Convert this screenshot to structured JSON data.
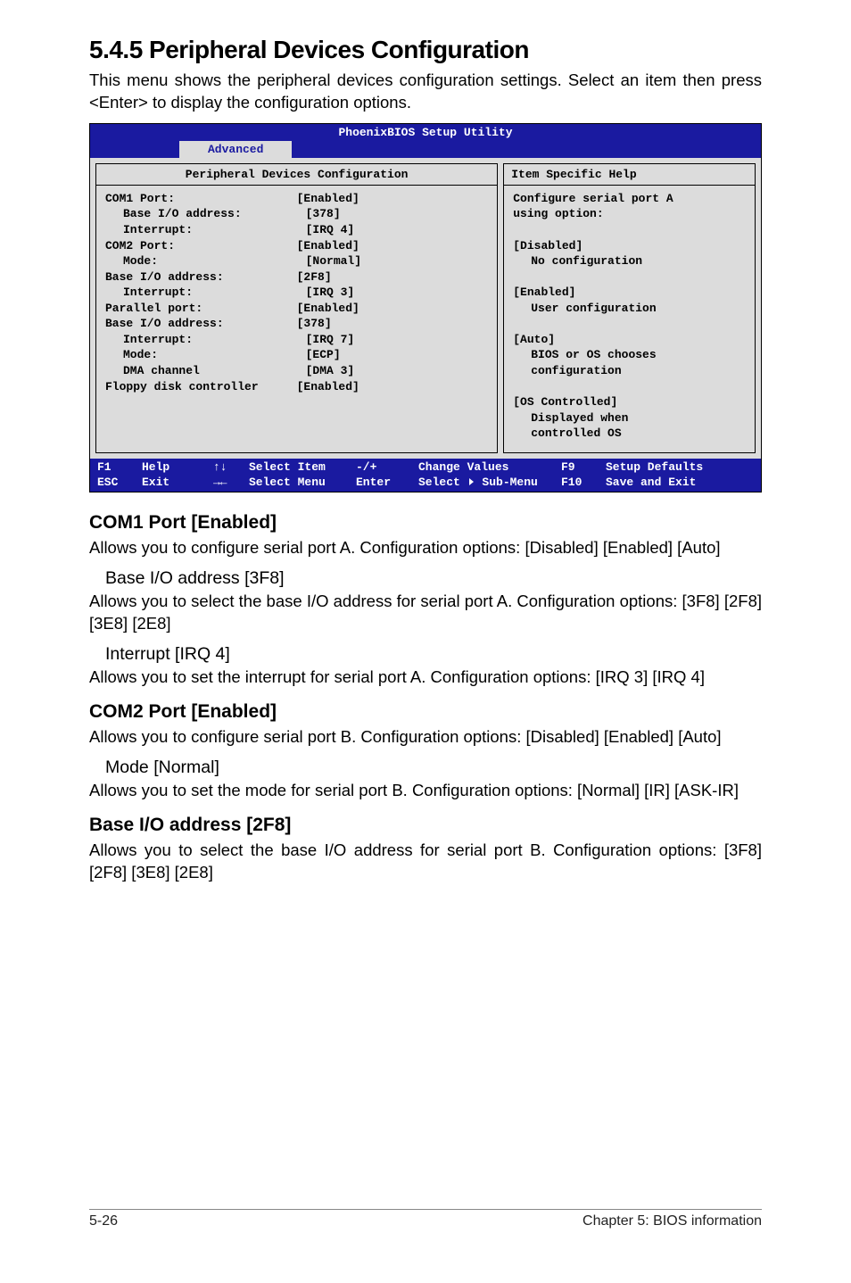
{
  "title": "5.4.5 Peripheral Devices Configuration",
  "intro": "This menu shows the peripheral devices configuration settings.  Select an item then press <Enter> to display the configuration options.",
  "bios": {
    "header": "PhoenixBIOS Setup Utility",
    "tab": "Advanced",
    "left_header": "Peripheral Devices Configuration",
    "right_header": "Item Specific Help",
    "settings": [
      {
        "label": "COM1 Port:",
        "value": "[Enabled]",
        "indent": 0
      },
      {
        "label": "Base I/O address:",
        "value": "[378]",
        "indent": 1
      },
      {
        "label": "Interrupt:",
        "value": "[IRQ 4]",
        "indent": 1
      },
      {
        "label": "COM2 Port:",
        "value": "[Enabled]",
        "indent": 0
      },
      {
        "label": "Mode:",
        "value": "[Normal]",
        "indent": 1
      },
      {
        "label": "Base I/O address:",
        "value": "[2F8]",
        "indent": 0
      },
      {
        "label": "Interrupt:",
        "value": "[IRQ 3]",
        "indent": 1
      },
      {
        "label": "Parallel port:",
        "value": "[Enabled]",
        "indent": 0
      },
      {
        "label": "Base I/O address:",
        "value": "[378]",
        "indent": 0
      },
      {
        "label": "Interrupt:",
        "value": "[IRQ 7]",
        "indent": 1
      },
      {
        "label": "Mode:",
        "value": "[ECP]",
        "indent": 1
      },
      {
        "label": "DMA channel",
        "value": "[DMA 3]",
        "indent": 1
      },
      {
        "label": "Floppy disk controller",
        "value": "[Enabled]",
        "indent": 0
      }
    ],
    "help_lines": [
      {
        "text": "Configure serial port A",
        "indent": 0
      },
      {
        "text": "using option:",
        "indent": 0
      },
      {
        "text": "",
        "indent": 0
      },
      {
        "text": "[Disabled]",
        "indent": 0
      },
      {
        "text": "No configuration",
        "indent": 1
      },
      {
        "text": "",
        "indent": 0
      },
      {
        "text": "[Enabled]",
        "indent": 0
      },
      {
        "text": "User configuration",
        "indent": 1
      },
      {
        "text": "",
        "indent": 0
      },
      {
        "text": "[Auto]",
        "indent": 0
      },
      {
        "text": "BIOS or OS chooses",
        "indent": 1
      },
      {
        "text": "configuration",
        "indent": 1
      },
      {
        "text": "",
        "indent": 0
      },
      {
        "text": "[OS Controlled]",
        "indent": 0
      },
      {
        "text": "Displayed when",
        "indent": 1
      },
      {
        "text": "controlled OS",
        "indent": 1
      }
    ],
    "footer": {
      "row1": {
        "k": "F1",
        "l": "Help",
        "sy": "↑↓",
        "ac": "Select Item",
        "k2": "-/+",
        "ac2": "Change Values",
        "kr": "F9",
        "acr": "Setup Defaults"
      },
      "row2": {
        "k": "ESC",
        "l": "Exit",
        "sy": "→←",
        "ac": "Select Menu",
        "k2": "Enter",
        "ac2_pre": "Select ",
        "ac2_post": " Sub-Menu",
        "kr": "F10",
        "acr": "Save and Exit"
      }
    }
  },
  "sections": {
    "com1_h": "COM1 Port [Enabled]",
    "com1_p": "Allows you to configure serial port A. Configuration options: [Disabled] [Enabled] [Auto]",
    "baseio_a_h": "Base I/O address [3F8]",
    "baseio_a_p": "Allows you to select the base I/O address for serial port A. Configuration options: [3F8] [2F8] [3E8] [2E8]",
    "int_a_h": "Interrupt [IRQ 4]",
    "int_a_p": "Allows you to set the interrupt for serial port A. Configuration options: [IRQ 3] [IRQ 4]",
    "com2_h": "COM2 Port [Enabled]",
    "com2_p": "Allows you to configure serial port B. Configuration options: [Disabled] [Enabled] [Auto]",
    "mode_h": "Mode [Normal]",
    "mode_p": "Allows you to set the mode for serial port B. Configuration options: [Normal] [IR] [ASK-IR]",
    "baseio_b_h": "Base I/O address [2F8]",
    "baseio_b_p": "Allows you to select the base I/O address for serial port B. Configuration options: [3F8] [2F8] [3E8] [2E8]"
  },
  "footer": {
    "left": "5-26",
    "right": "Chapter 5: BIOS information"
  }
}
